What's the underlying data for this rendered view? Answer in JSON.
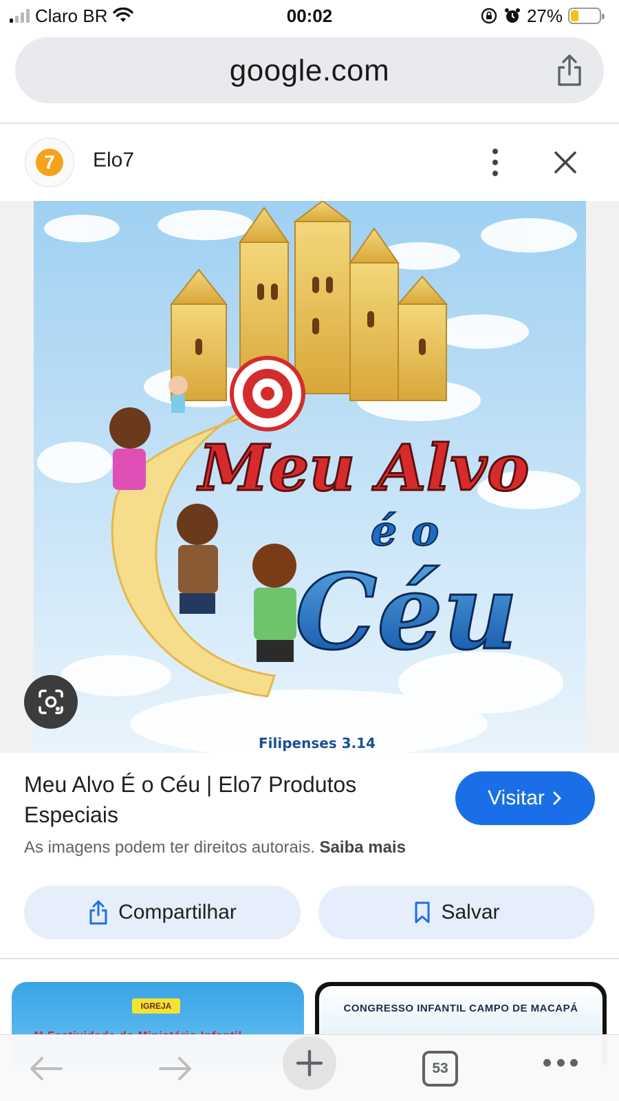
{
  "status_bar": {
    "carrier": "Claro BR",
    "time": "00:02",
    "battery_percent": "27%",
    "battery_level": 0.27,
    "icons": [
      "signal-icon",
      "wifi-icon",
      "orientation-lock-icon",
      "alarm-icon",
      "battery-icon"
    ]
  },
  "browser": {
    "url": "google.com",
    "tab_count": "53"
  },
  "source": {
    "name": "Elo7",
    "favicon_letter": "7",
    "favicon_color": "#f6a21b"
  },
  "poster": {
    "line1": "Meu Alvo",
    "line2": "é o",
    "line3": "Céu",
    "verse": "Filipenses 3.14"
  },
  "result": {
    "title": "Meu Alvo É o Céu | Elo7 Produtos Especiais",
    "visit_label": "Visitar",
    "copyright_text": "As imagens podem ter direitos autorais.",
    "learn_more": "Saiba mais",
    "share_label": "Compartilhar",
    "save_label": "Salvar",
    "accent_color": "#1a6fe8"
  },
  "related": [
    {
      "badge": "IGREJA",
      "caption": "4ª Festividade do Ministério Infantil"
    },
    {
      "caption": "CONGRESSO INFANTIL CAMPO DE MACAPÁ"
    }
  ]
}
